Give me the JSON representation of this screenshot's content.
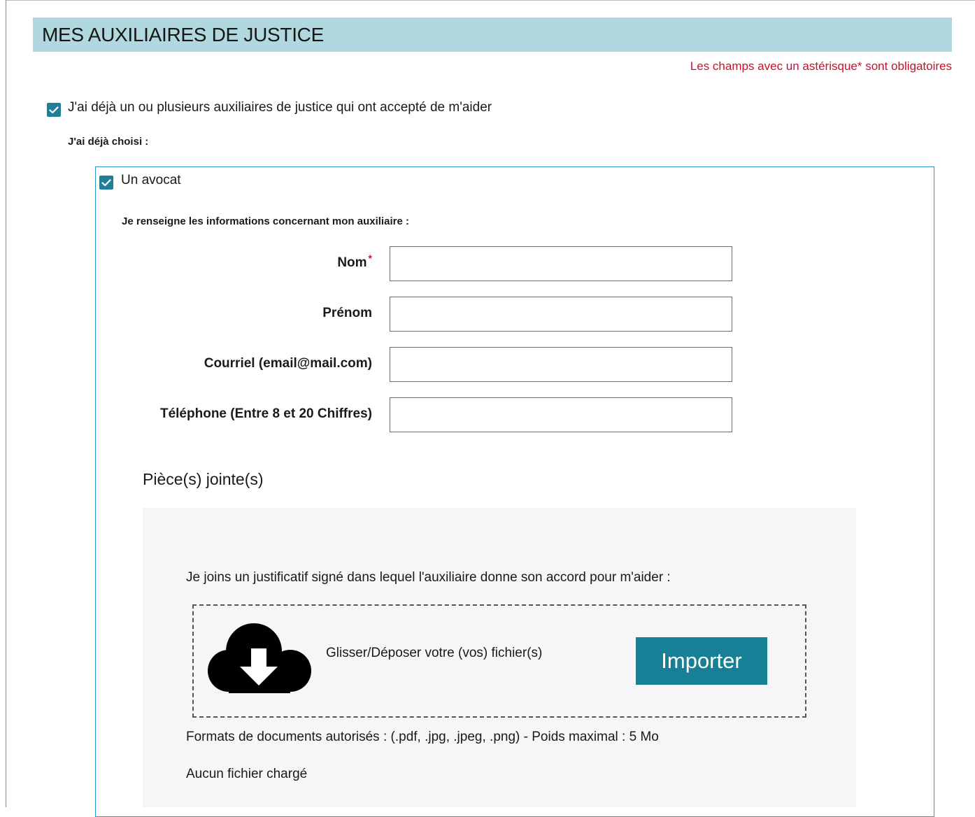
{
  "section": {
    "title": "MES AUXILIAIRES DE JUSTICE",
    "required_note": "Les champs avec un astérisque* sont obligatoires"
  },
  "auxiliaires": {
    "has_aux_label": "J'ai déjà un ou plusieurs auxiliaires de justice qui ont accepté de m'aider",
    "has_aux_checked": true,
    "already_chosen_label": "J'ai déjà choisi :"
  },
  "avocat": {
    "checkbox_label": "Un avocat",
    "checked": true,
    "info_label": "Je renseigne les informations concernant mon auxiliaire :",
    "fields": {
      "nom": {
        "label": "Nom",
        "required_mark": "*",
        "value": ""
      },
      "prenom": {
        "label": "Prénom",
        "value": ""
      },
      "courriel": {
        "label": "Courriel (email@mail.com)",
        "value": ""
      },
      "telephone": {
        "label": "Téléphone (Entre 8 et 20 Chiffres)",
        "value": ""
      }
    }
  },
  "attachments": {
    "title": "Pièce(s) jointe(s)",
    "instruction": "Je joins un justificatif signé dans lequel l'auxiliaire donne son accord pour m'aider :",
    "drop_text": "Glisser/Déposer votre (vos) fichier(s)",
    "import_label": "Importer",
    "formats_text": "Formats de documents autorisés : (.pdf, .jpg, .jpeg, .png) - Poids maximal : 5 Mo",
    "no_file_text": "Aucun fichier chargé",
    "icon": "cloud-download-icon"
  },
  "colors": {
    "header_bg": "#b0d8de",
    "accent": "#177f96",
    "required": "#c8102e",
    "box_border": "#2b95c6",
    "panel_bg": "#f6f6f9"
  }
}
